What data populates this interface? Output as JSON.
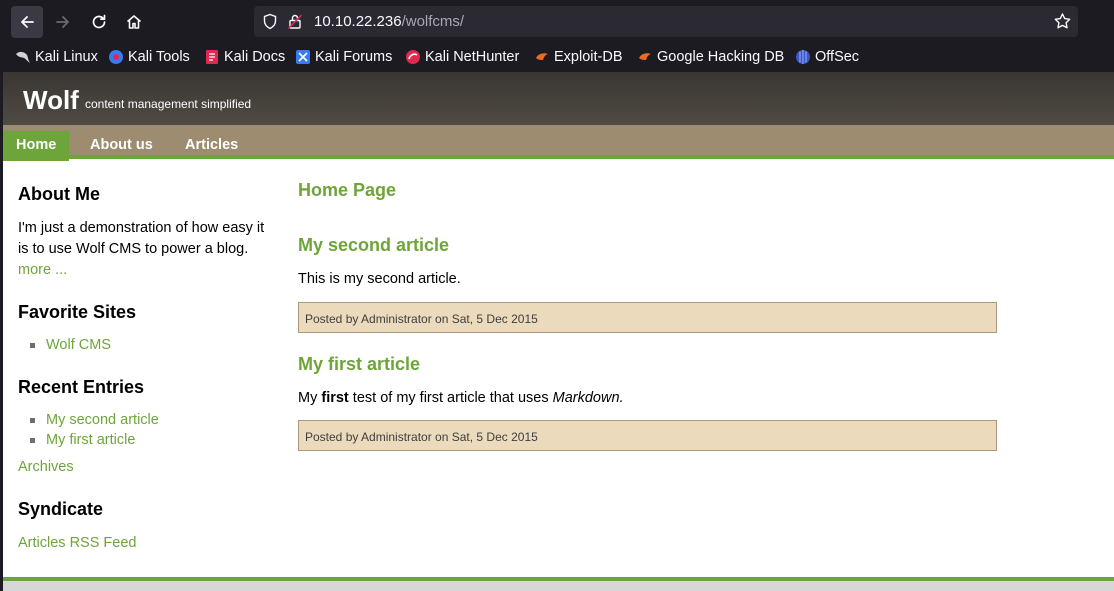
{
  "browser": {
    "url_host": "10.10.22.236",
    "url_path": "/wolfcms/",
    "bookmarks": [
      "Kali Linux",
      "Kali Tools",
      "Kali Docs",
      "Kali Forums",
      "Kali NetHunter",
      "Exploit-DB",
      "Google Hacking DB",
      "OffSec"
    ]
  },
  "site": {
    "title": "Wolf",
    "slogan": "content management simplified"
  },
  "nav": [
    "Home",
    "About us",
    "Articles"
  ],
  "sidebar": {
    "about_heading": "About Me",
    "about_text": "I'm just a demonstration of how easy it is to use Wolf CMS to power a blog.",
    "more_link": "more ...",
    "favorites_heading": "Favorite Sites",
    "favorites": [
      "Wolf CMS"
    ],
    "recent_heading": "Recent Entries",
    "recent": [
      "My second article",
      "My first article"
    ],
    "archives_link": "Archives",
    "syndicate_heading": "Syndicate",
    "rss_link": "Articles RSS Feed"
  },
  "main": {
    "page_title": "Home Page",
    "articles": [
      {
        "title": "My second article",
        "body": "This is my second article.",
        "info": "Posted by Administrator on Sat, 5 Dec 2015"
      },
      {
        "title": "My first article",
        "body_pre": "My ",
        "body_bold": "first",
        "body_mid": " test of my first article that uses ",
        "body_italic": "Markdown.",
        "info": "Posted by Administrator on Sat, 5 Dec 2015"
      }
    ]
  },
  "colors": {
    "accent": "#6ea53a",
    "nav_bg": "#9d8c6f",
    "header_bg": "#4a4540",
    "postinfo_bg": "#ebdbbc"
  }
}
